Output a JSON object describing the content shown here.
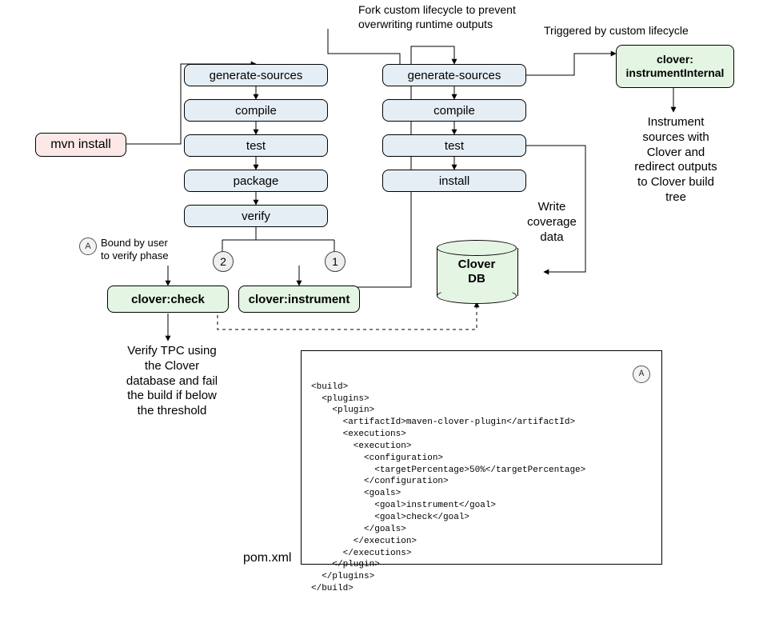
{
  "annotations": {
    "fork_note": "Fork custom lifecycle to prevent\noverwriting runtime outputs",
    "trigger_note": "Triggered by custom lifecycle",
    "bound_note": "Bound by user\nto verify phase",
    "instrument_note": "Instrument\nsources with\nClover and\nredirect outputs\nto Clover build\ntree",
    "write_note": "Write\ncoverage\ndata",
    "verify_note": "Verify TPC using\nthe Clover\ndatabase and fail\nthe build if below\nthe threshold",
    "pom_label": "pom.xml",
    "badge_a": "A",
    "num_1": "1",
    "num_2": "2"
  },
  "mvn": {
    "label": "mvn install"
  },
  "left_phases": {
    "p1": "generate-sources",
    "p2": "compile",
    "p3": "test",
    "p4": "package",
    "p5": "verify"
  },
  "right_phases": {
    "p1": "generate-sources",
    "p2": "compile",
    "p3": "test",
    "p4": "install"
  },
  "clover": {
    "check": "clover:check",
    "instrument": "clover:instrument",
    "instrument_internal": "clover:\ninstrumentInternal",
    "db": "Clover\nDB"
  },
  "pom_xml": "<build>\n  <plugins>\n    <plugin>\n      <artifactId>maven-clover-plugin</artifactId>\n      <executions>\n        <execution>\n          <configuration>\n            <targetPercentage>50%</targetPercentage>\n          </configuration>\n          <goals>\n            <goal>instrument</goal>\n            <goal>check</goal>\n          </goals>\n        </execution>\n      </executions>\n    </plugin>\n  </plugins>\n</build>"
}
